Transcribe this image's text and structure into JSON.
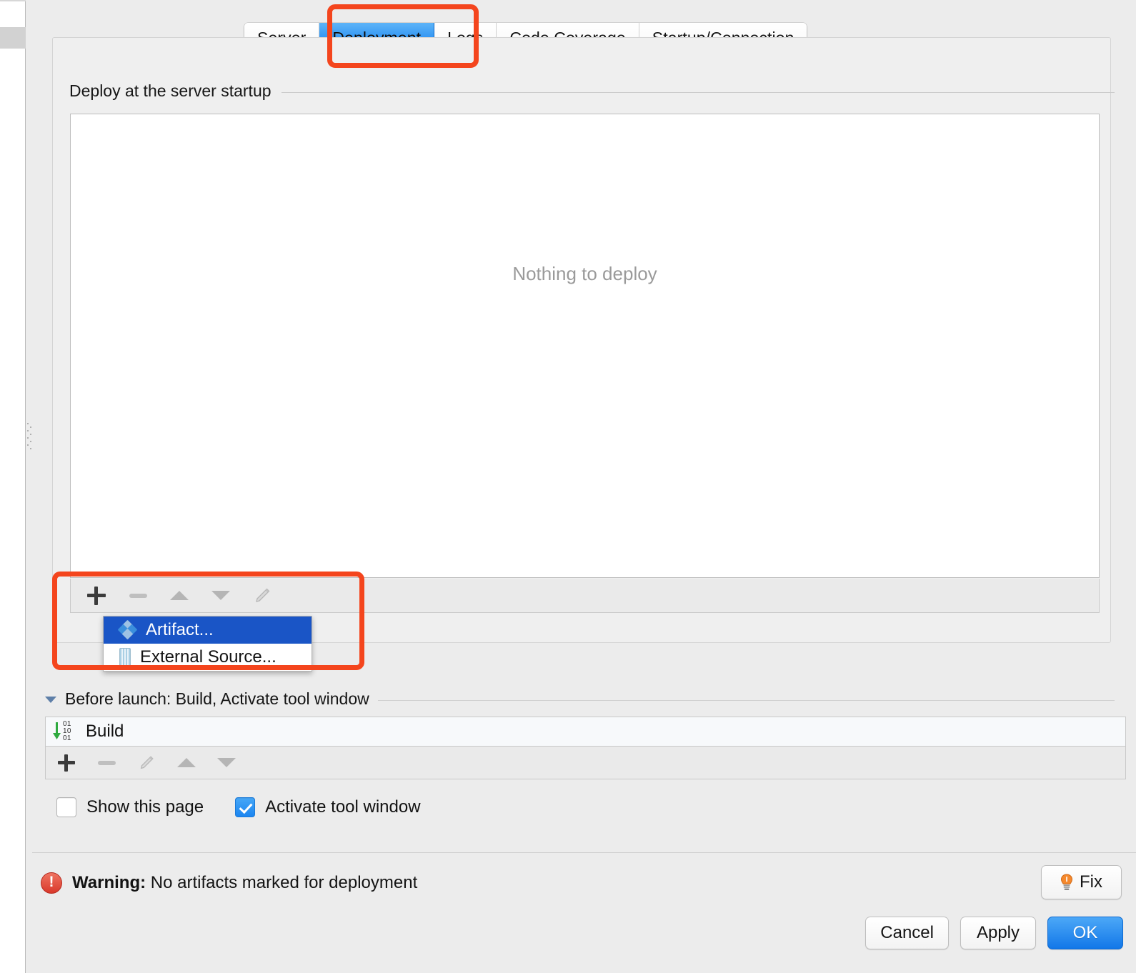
{
  "tabs": [
    {
      "label": "Server",
      "selected": false
    },
    {
      "label": "Deployment",
      "selected": true
    },
    {
      "label": "Logs",
      "selected": false
    },
    {
      "label": "Code Coverage",
      "selected": false
    },
    {
      "label": "Startup/Connection",
      "selected": false
    }
  ],
  "deployment": {
    "group_label": "Deploy at the server startup",
    "empty_text": "Nothing to deploy",
    "toolbar": {
      "add": "+",
      "remove": "−",
      "move_up": "▲",
      "move_down": "▼",
      "edit": "edit"
    }
  },
  "add_menu": {
    "items": [
      {
        "label": "Artifact...",
        "icon": "artifact-diamond-icon",
        "highlighted": true
      },
      {
        "label": "External Source...",
        "icon": "external-source-archive-icon",
        "highlighted": false
      }
    ]
  },
  "before_launch": {
    "title": "Before launch: Build, Activate tool window",
    "tasks": [
      {
        "label": "Build",
        "icon": "compile-build-icon"
      }
    ],
    "toolbar": {
      "add": "+",
      "remove": "−",
      "edit": "edit",
      "move_up": "▲",
      "move_down": "▼"
    }
  },
  "options": [
    {
      "label": "Show this page",
      "checked": false
    },
    {
      "label": "Activate tool window",
      "checked": true
    }
  ],
  "warning": {
    "prefix": "Warning:",
    "message": " No artifacts marked for deployment",
    "fix_label": "Fix"
  },
  "buttons": {
    "cancel": "Cancel",
    "apply": "Apply",
    "ok": "OK"
  },
  "colors": {
    "selected_tab_blue": "#0b78ef",
    "menu_highlight_blue": "#1a55c6",
    "annotation_red": "#f4451d",
    "warning_red": "#d9392b",
    "checkbox_blue": "#1b85f0",
    "build_arrow_green": "#2faa3f",
    "primary_button_blue": "#1277e8"
  }
}
